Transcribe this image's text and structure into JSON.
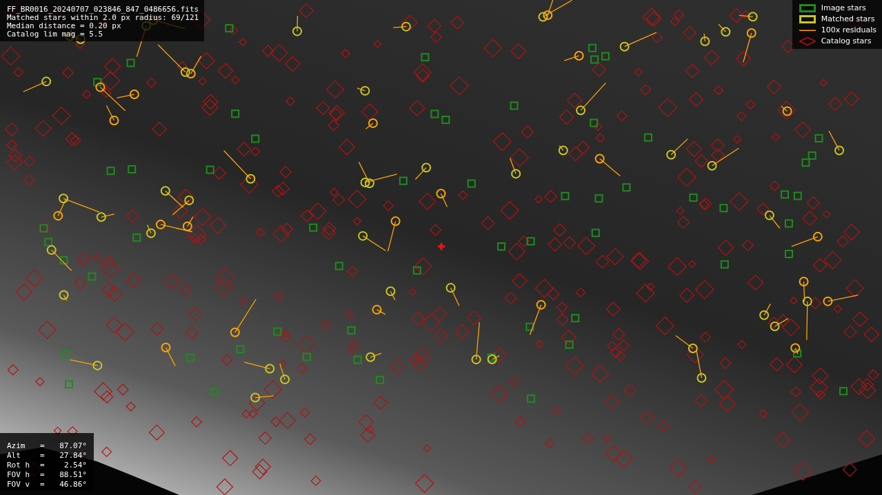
{
  "info": {
    "lines": [
      "FF_BR0016_20240707_023846_847_0486656.fits",
      "Matched stars within 2.0 px radius: 69/121",
      "Median distance = 0.20 px",
      "Catalog lim mag = 5.5"
    ]
  },
  "legend": [
    {
      "kind": "box",
      "label": "Image stars",
      "color": "#1e8c1e"
    },
    {
      "kind": "box",
      "label": "Matched stars",
      "color": "#c8c81e"
    },
    {
      "kind": "line",
      "label": "100x residuals",
      "color": "#ffa500"
    },
    {
      "kind": "diamond",
      "label": "Catalog stars",
      "color": "#b01414"
    }
  ],
  "pointing": [
    {
      "label": "Azim",
      "sign": "=",
      "value": "87.07°"
    },
    {
      "label": "Alt",
      "sign": "=",
      "value": "27.84°"
    },
    {
      "label": "Rot h",
      "sign": "=",
      "value": "2.54°"
    },
    {
      "label": "FOV h",
      "sign": "=",
      "value": "88.51°"
    },
    {
      "label": "FOV v",
      "sign": "=",
      "value": "46.86°"
    }
  ]
}
